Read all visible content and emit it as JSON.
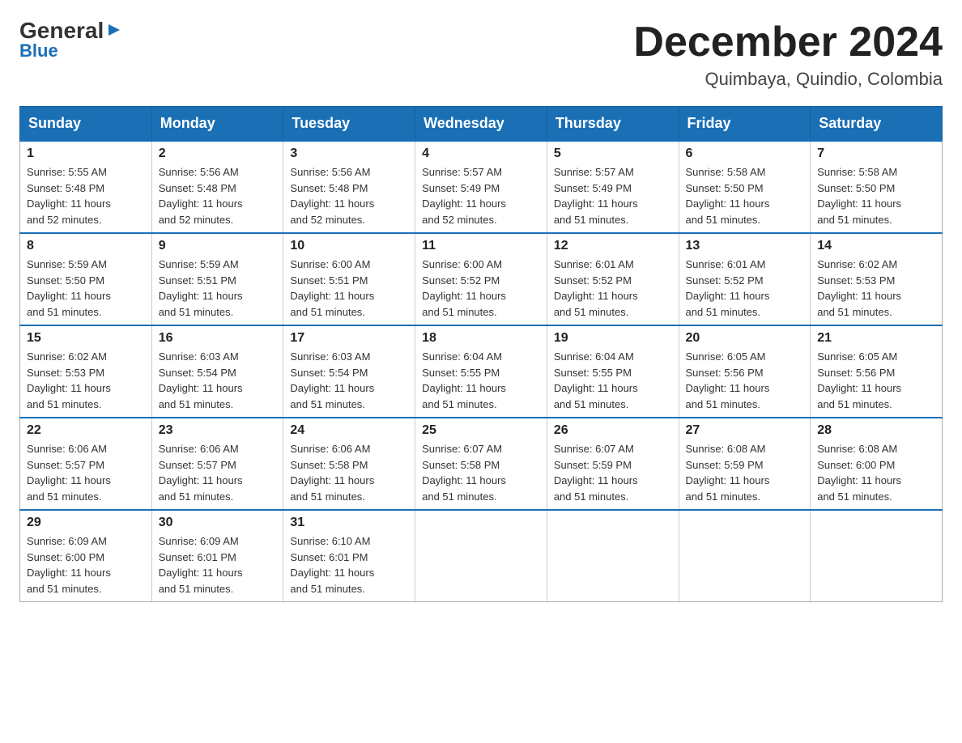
{
  "logo": {
    "general": "General",
    "triangle": "▶",
    "blue": "Blue"
  },
  "title": "December 2024",
  "location": "Quimbaya, Quindio, Colombia",
  "headers": [
    "Sunday",
    "Monday",
    "Tuesday",
    "Wednesday",
    "Thursday",
    "Friday",
    "Saturday"
  ],
  "weeks": [
    [
      {
        "day": "1",
        "sunrise": "5:55 AM",
        "sunset": "5:48 PM",
        "daylight": "11 hours and 52 minutes."
      },
      {
        "day": "2",
        "sunrise": "5:56 AM",
        "sunset": "5:48 PM",
        "daylight": "11 hours and 52 minutes."
      },
      {
        "day": "3",
        "sunrise": "5:56 AM",
        "sunset": "5:48 PM",
        "daylight": "11 hours and 52 minutes."
      },
      {
        "day": "4",
        "sunrise": "5:57 AM",
        "sunset": "5:49 PM",
        "daylight": "11 hours and 52 minutes."
      },
      {
        "day": "5",
        "sunrise": "5:57 AM",
        "sunset": "5:49 PM",
        "daylight": "11 hours and 51 minutes."
      },
      {
        "day": "6",
        "sunrise": "5:58 AM",
        "sunset": "5:50 PM",
        "daylight": "11 hours and 51 minutes."
      },
      {
        "day": "7",
        "sunrise": "5:58 AM",
        "sunset": "5:50 PM",
        "daylight": "11 hours and 51 minutes."
      }
    ],
    [
      {
        "day": "8",
        "sunrise": "5:59 AM",
        "sunset": "5:50 PM",
        "daylight": "11 hours and 51 minutes."
      },
      {
        "day": "9",
        "sunrise": "5:59 AM",
        "sunset": "5:51 PM",
        "daylight": "11 hours and 51 minutes."
      },
      {
        "day": "10",
        "sunrise": "6:00 AM",
        "sunset": "5:51 PM",
        "daylight": "11 hours and 51 minutes."
      },
      {
        "day": "11",
        "sunrise": "6:00 AM",
        "sunset": "5:52 PM",
        "daylight": "11 hours and 51 minutes."
      },
      {
        "day": "12",
        "sunrise": "6:01 AM",
        "sunset": "5:52 PM",
        "daylight": "11 hours and 51 minutes."
      },
      {
        "day": "13",
        "sunrise": "6:01 AM",
        "sunset": "5:52 PM",
        "daylight": "11 hours and 51 minutes."
      },
      {
        "day": "14",
        "sunrise": "6:02 AM",
        "sunset": "5:53 PM",
        "daylight": "11 hours and 51 minutes."
      }
    ],
    [
      {
        "day": "15",
        "sunrise": "6:02 AM",
        "sunset": "5:53 PM",
        "daylight": "11 hours and 51 minutes."
      },
      {
        "day": "16",
        "sunrise": "6:03 AM",
        "sunset": "5:54 PM",
        "daylight": "11 hours and 51 minutes."
      },
      {
        "day": "17",
        "sunrise": "6:03 AM",
        "sunset": "5:54 PM",
        "daylight": "11 hours and 51 minutes."
      },
      {
        "day": "18",
        "sunrise": "6:04 AM",
        "sunset": "5:55 PM",
        "daylight": "11 hours and 51 minutes."
      },
      {
        "day": "19",
        "sunrise": "6:04 AM",
        "sunset": "5:55 PM",
        "daylight": "11 hours and 51 minutes."
      },
      {
        "day": "20",
        "sunrise": "6:05 AM",
        "sunset": "5:56 PM",
        "daylight": "11 hours and 51 minutes."
      },
      {
        "day": "21",
        "sunrise": "6:05 AM",
        "sunset": "5:56 PM",
        "daylight": "11 hours and 51 minutes."
      }
    ],
    [
      {
        "day": "22",
        "sunrise": "6:06 AM",
        "sunset": "5:57 PM",
        "daylight": "11 hours and 51 minutes."
      },
      {
        "day": "23",
        "sunrise": "6:06 AM",
        "sunset": "5:57 PM",
        "daylight": "11 hours and 51 minutes."
      },
      {
        "day": "24",
        "sunrise": "6:06 AM",
        "sunset": "5:58 PM",
        "daylight": "11 hours and 51 minutes."
      },
      {
        "day": "25",
        "sunrise": "6:07 AM",
        "sunset": "5:58 PM",
        "daylight": "11 hours and 51 minutes."
      },
      {
        "day": "26",
        "sunrise": "6:07 AM",
        "sunset": "5:59 PM",
        "daylight": "11 hours and 51 minutes."
      },
      {
        "day": "27",
        "sunrise": "6:08 AM",
        "sunset": "5:59 PM",
        "daylight": "11 hours and 51 minutes."
      },
      {
        "day": "28",
        "sunrise": "6:08 AM",
        "sunset": "6:00 PM",
        "daylight": "11 hours and 51 minutes."
      }
    ],
    [
      {
        "day": "29",
        "sunrise": "6:09 AM",
        "sunset": "6:00 PM",
        "daylight": "11 hours and 51 minutes."
      },
      {
        "day": "30",
        "sunrise": "6:09 AM",
        "sunset": "6:01 PM",
        "daylight": "11 hours and 51 minutes."
      },
      {
        "day": "31",
        "sunrise": "6:10 AM",
        "sunset": "6:01 PM",
        "daylight": "11 hours and 51 minutes."
      },
      null,
      null,
      null,
      null
    ]
  ],
  "labels": {
    "sunrise": "Sunrise:",
    "sunset": "Sunset:",
    "daylight": "Daylight:"
  }
}
